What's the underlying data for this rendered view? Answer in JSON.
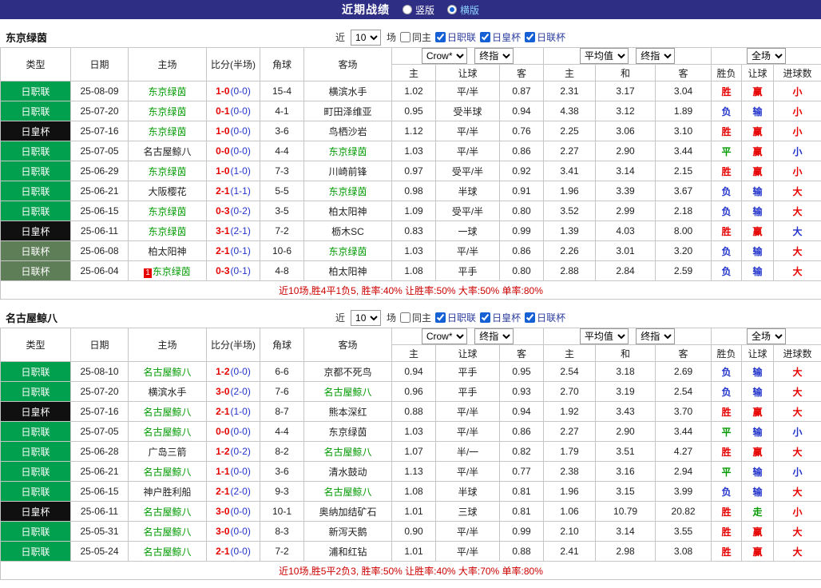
{
  "colors": {
    "topbar_bg": "#2e2e85",
    "selected_radio_label": "#8fd3ff",
    "league_j1_bg": "#00a04e",
    "league_cup_bg": "#101010",
    "league_lc_bg": "#5e7e58",
    "focus_team": "#009900",
    "win_red": "#e60000",
    "draw_green": "#009900",
    "loss_blue": "#2233cc",
    "summary_red": "#cc0000"
  },
  "top_bar": {
    "title": "近期战绩",
    "options": [
      {
        "label": "竖版",
        "selected": false
      },
      {
        "label": "横版",
        "selected": true
      }
    ]
  },
  "filters": {
    "recent": "近",
    "count": "10",
    "games": "场",
    "same_home": "同主",
    "league_1": "日职联",
    "league_2": "日皇杯",
    "league_3": "日联杯"
  },
  "header": {
    "type": "类型",
    "date": "日期",
    "home": "主场",
    "score": "比分(半场)",
    "corner": "角球",
    "away": "客场",
    "odds_source": "Crow*",
    "odds_mode": "终指",
    "avg_source": "平均值",
    "avg_mode": "终指",
    "scope": "全场",
    "sub_home": "主",
    "sub_handicap": "让球",
    "sub_away": "客",
    "sub_avg_home": "主",
    "sub_avg_draw": "和",
    "sub_avg_away": "客",
    "sub_result": "胜负",
    "sub_hresult": "让球",
    "sub_goals": "进球数"
  },
  "sections": [
    {
      "team": "东京绿茵",
      "summary": "近10场,胜4平1负5, 胜率:40% 让胜率:50% 大率:50% 单率:80%",
      "rows": [
        {
          "league": "日职联",
          "date": "25-08-09",
          "home": "东京绿茵",
          "score": "1-0",
          "half": "(0-0)",
          "corner": "15-4",
          "away": "横滨水手",
          "oh": "1.02",
          "hc": "平/半",
          "oa": "0.87",
          "ah": "2.31",
          "ad": "3.17",
          "aa": "3.04",
          "res": "胜",
          "res_c": "r",
          "hr": "赢",
          "hr_c": "r",
          "gl": "小",
          "gl_c": "r"
        },
        {
          "league": "日职联",
          "date": "25-07-20",
          "home": "东京绿茵",
          "score": "0-1",
          "half": "(0-0)",
          "corner": "4-1",
          "away": "町田泽维亚",
          "oh": "0.95",
          "hc": "受半球",
          "oa": "0.94",
          "ah": "4.38",
          "ad": "3.12",
          "aa": "1.89",
          "res": "负",
          "res_c": "b",
          "hr": "输",
          "hr_c": "b",
          "gl": "小",
          "gl_c": "r"
        },
        {
          "league": "日皇杯",
          "date": "25-07-16",
          "home": "东京绿茵",
          "score": "1-0",
          "half": "(0-0)",
          "corner": "3-6",
          "away": "鸟栖沙岩",
          "oh": "1.12",
          "hc": "平/半",
          "oa": "0.76",
          "ah": "2.25",
          "ad": "3.06",
          "aa": "3.10",
          "res": "胜",
          "res_c": "r",
          "hr": "赢",
          "hr_c": "r",
          "gl": "小",
          "gl_c": "r"
        },
        {
          "league": "日职联",
          "date": "25-07-05",
          "home": "名古屋鲸八",
          "score": "0-0",
          "half": "(0-0)",
          "corner": "4-4",
          "away": "东京绿茵",
          "oh": "1.03",
          "hc": "平/半",
          "oa": "0.86",
          "ah": "2.27",
          "ad": "2.90",
          "aa": "3.44",
          "res": "平",
          "res_c": "g",
          "hr": "赢",
          "hr_c": "r",
          "gl": "小",
          "gl_c": "b"
        },
        {
          "league": "日职联",
          "date": "25-06-29",
          "home": "东京绿茵",
          "score": "1-0",
          "half": "(1-0)",
          "corner": "7-3",
          "away": "川崎前锋",
          "oh": "0.97",
          "hc": "受平/半",
          "oa": "0.92",
          "ah": "3.41",
          "ad": "3.14",
          "aa": "2.15",
          "res": "胜",
          "res_c": "r",
          "hr": "赢",
          "hr_c": "r",
          "gl": "小",
          "gl_c": "r"
        },
        {
          "league": "日职联",
          "date": "25-06-21",
          "home": "大阪樱花",
          "score": "2-1",
          "half": "(1-1)",
          "corner": "5-5",
          "away": "东京绿茵",
          "oh": "0.98",
          "hc": "半球",
          "oa": "0.91",
          "ah": "1.96",
          "ad": "3.39",
          "aa": "3.67",
          "res": "负",
          "res_c": "b",
          "hr": "输",
          "hr_c": "b",
          "gl": "大",
          "gl_c": "r"
        },
        {
          "league": "日职联",
          "date": "25-06-15",
          "home": "东京绿茵",
          "score": "0-3",
          "half": "(0-2)",
          "corner": "3-5",
          "away": "柏太阳神",
          "oh": "1.09",
          "hc": "受平/半",
          "oa": "0.80",
          "ah": "3.52",
          "ad": "2.99",
          "aa": "2.18",
          "res": "负",
          "res_c": "b",
          "hr": "输",
          "hr_c": "b",
          "gl": "大",
          "gl_c": "r"
        },
        {
          "league": "日皇杯",
          "date": "25-06-11",
          "home": "东京绿茵",
          "score": "3-1",
          "half": "(2-1)",
          "corner": "7-2",
          "away": "枥木SC",
          "oh": "0.83",
          "hc": "一球",
          "oa": "0.99",
          "ah": "1.39",
          "ad": "4.03",
          "aa": "8.00",
          "res": "胜",
          "res_c": "r",
          "hr": "赢",
          "hr_c": "r",
          "gl": "大",
          "gl_c": "b"
        },
        {
          "league": "日联杯",
          "date": "25-06-08",
          "home": "柏太阳神",
          "score": "2-1",
          "half": "(0-1)",
          "corner": "10-6",
          "away": "东京绿茵",
          "oh": "1.03",
          "hc": "平/半",
          "oa": "0.86",
          "ah": "2.26",
          "ad": "3.01",
          "aa": "3.20",
          "res": "负",
          "res_c": "b",
          "hr": "输",
          "hr_c": "b",
          "gl": "大",
          "gl_c": "r"
        },
        {
          "league": "日联杯",
          "date": "25-06-04",
          "home": "东京绿茵",
          "home_badge": "1",
          "score": "0-3",
          "half": "(0-1)",
          "corner": "4-8",
          "away": "柏太阳神",
          "oh": "1.08",
          "hc": "平手",
          "oa": "0.80",
          "ah": "2.88",
          "ad": "2.84",
          "aa": "2.59",
          "res": "负",
          "res_c": "b",
          "hr": "输",
          "hr_c": "b",
          "gl": "大",
          "gl_c": "r"
        }
      ]
    },
    {
      "team": "名古屋鲸八",
      "summary": "近10场,胜5平2负3, 胜率:50% 让胜率:40% 大率:70% 单率:80%",
      "rows": [
        {
          "league": "日职联",
          "date": "25-08-10",
          "home": "名古屋鲸八",
          "score": "1-2",
          "half": "(0-0)",
          "corner": "6-6",
          "away": "京都不死鸟",
          "oh": "0.94",
          "hc": "平手",
          "oa": "0.95",
          "ah": "2.54",
          "ad": "3.18",
          "aa": "2.69",
          "res": "负",
          "res_c": "b",
          "hr": "输",
          "hr_c": "b",
          "gl": "大",
          "gl_c": "r"
        },
        {
          "league": "日职联",
          "date": "25-07-20",
          "home": "横滨水手",
          "score": "3-0",
          "half": "(2-0)",
          "corner": "7-6",
          "away": "名古屋鲸八",
          "oh": "0.96",
          "hc": "平手",
          "oa": "0.93",
          "ah": "2.70",
          "ad": "3.19",
          "aa": "2.54",
          "res": "负",
          "res_c": "b",
          "hr": "输",
          "hr_c": "b",
          "gl": "大",
          "gl_c": "r"
        },
        {
          "league": "日皇杯",
          "date": "25-07-16",
          "home": "名古屋鲸八",
          "score": "2-1",
          "half": "(1-0)",
          "corner": "8-7",
          "away": "熊本深红",
          "oh": "0.88",
          "hc": "平/半",
          "oa": "0.94",
          "ah": "1.92",
          "ad": "3.43",
          "aa": "3.70",
          "res": "胜",
          "res_c": "r",
          "hr": "赢",
          "hr_c": "r",
          "gl": "大",
          "gl_c": "r"
        },
        {
          "league": "日职联",
          "date": "25-07-05",
          "home": "名古屋鲸八",
          "score": "0-0",
          "half": "(0-0)",
          "corner": "4-4",
          "away": "东京绿茵",
          "oh": "1.03",
          "hc": "平/半",
          "oa": "0.86",
          "ah": "2.27",
          "ad": "2.90",
          "aa": "3.44",
          "res": "平",
          "res_c": "g",
          "hr": "输",
          "hr_c": "b",
          "gl": "小",
          "gl_c": "b"
        },
        {
          "league": "日职联",
          "date": "25-06-28",
          "home": "广岛三箭",
          "score": "1-2",
          "half": "(0-2)",
          "corner": "8-2",
          "away": "名古屋鲸八",
          "oh": "1.07",
          "hc": "半/一",
          "oa": "0.82",
          "ah": "1.79",
          "ad": "3.51",
          "aa": "4.27",
          "res": "胜",
          "res_c": "r",
          "hr": "赢",
          "hr_c": "r",
          "gl": "大",
          "gl_c": "r"
        },
        {
          "league": "日职联",
          "date": "25-06-21",
          "home": "名古屋鲸八",
          "score": "1-1",
          "half": "(0-0)",
          "corner": "3-6",
          "away": "清水鼓动",
          "oh": "1.13",
          "hc": "平/半",
          "oa": "0.77",
          "ah": "2.38",
          "ad": "3.16",
          "aa": "2.94",
          "res": "平",
          "res_c": "g",
          "hr": "输",
          "hr_c": "b",
          "gl": "小",
          "gl_c": "b"
        },
        {
          "league": "日职联",
          "date": "25-06-15",
          "home": "神户胜利船",
          "score": "2-1",
          "half": "(2-0)",
          "corner": "9-3",
          "away": "名古屋鲸八",
          "oh": "1.08",
          "hc": "半球",
          "oa": "0.81",
          "ah": "1.96",
          "ad": "3.15",
          "aa": "3.99",
          "res": "负",
          "res_c": "b",
          "hr": "输",
          "hr_c": "b",
          "gl": "大",
          "gl_c": "r"
        },
        {
          "league": "日皇杯",
          "date": "25-06-11",
          "home": "名古屋鲸八",
          "score": "3-0",
          "half": "(0-0)",
          "corner": "10-1",
          "away": "奥纳加结矿石",
          "oh": "1.01",
          "hc": "三球",
          "oa": "0.81",
          "ah": "1.06",
          "ad": "10.79",
          "aa": "20.82",
          "res": "胜",
          "res_c": "r",
          "hr": "走",
          "hr_c": "g",
          "gl": "小",
          "gl_c": "r"
        },
        {
          "league": "日职联",
          "date": "25-05-31",
          "home": "名古屋鲸八",
          "score": "3-0",
          "half": "(0-0)",
          "corner": "8-3",
          "away": "新泻天鹅",
          "oh": "0.90",
          "hc": "平/半",
          "oa": "0.99",
          "ah": "2.10",
          "ad": "3.14",
          "aa": "3.55",
          "res": "胜",
          "res_c": "r",
          "hr": "赢",
          "hr_c": "r",
          "gl": "大",
          "gl_c": "r"
        },
        {
          "league": "日职联",
          "date": "25-05-24",
          "home": "名古屋鲸八",
          "score": "2-1",
          "half": "(0-0)",
          "corner": "7-2",
          "away": "浦和红钻",
          "oh": "1.01",
          "hc": "平/半",
          "oa": "0.88",
          "ah": "2.41",
          "ad": "2.98",
          "aa": "3.08",
          "res": "胜",
          "res_c": "r",
          "hr": "赢",
          "hr_c": "r",
          "gl": "大",
          "gl_c": "r"
        }
      ]
    }
  ]
}
